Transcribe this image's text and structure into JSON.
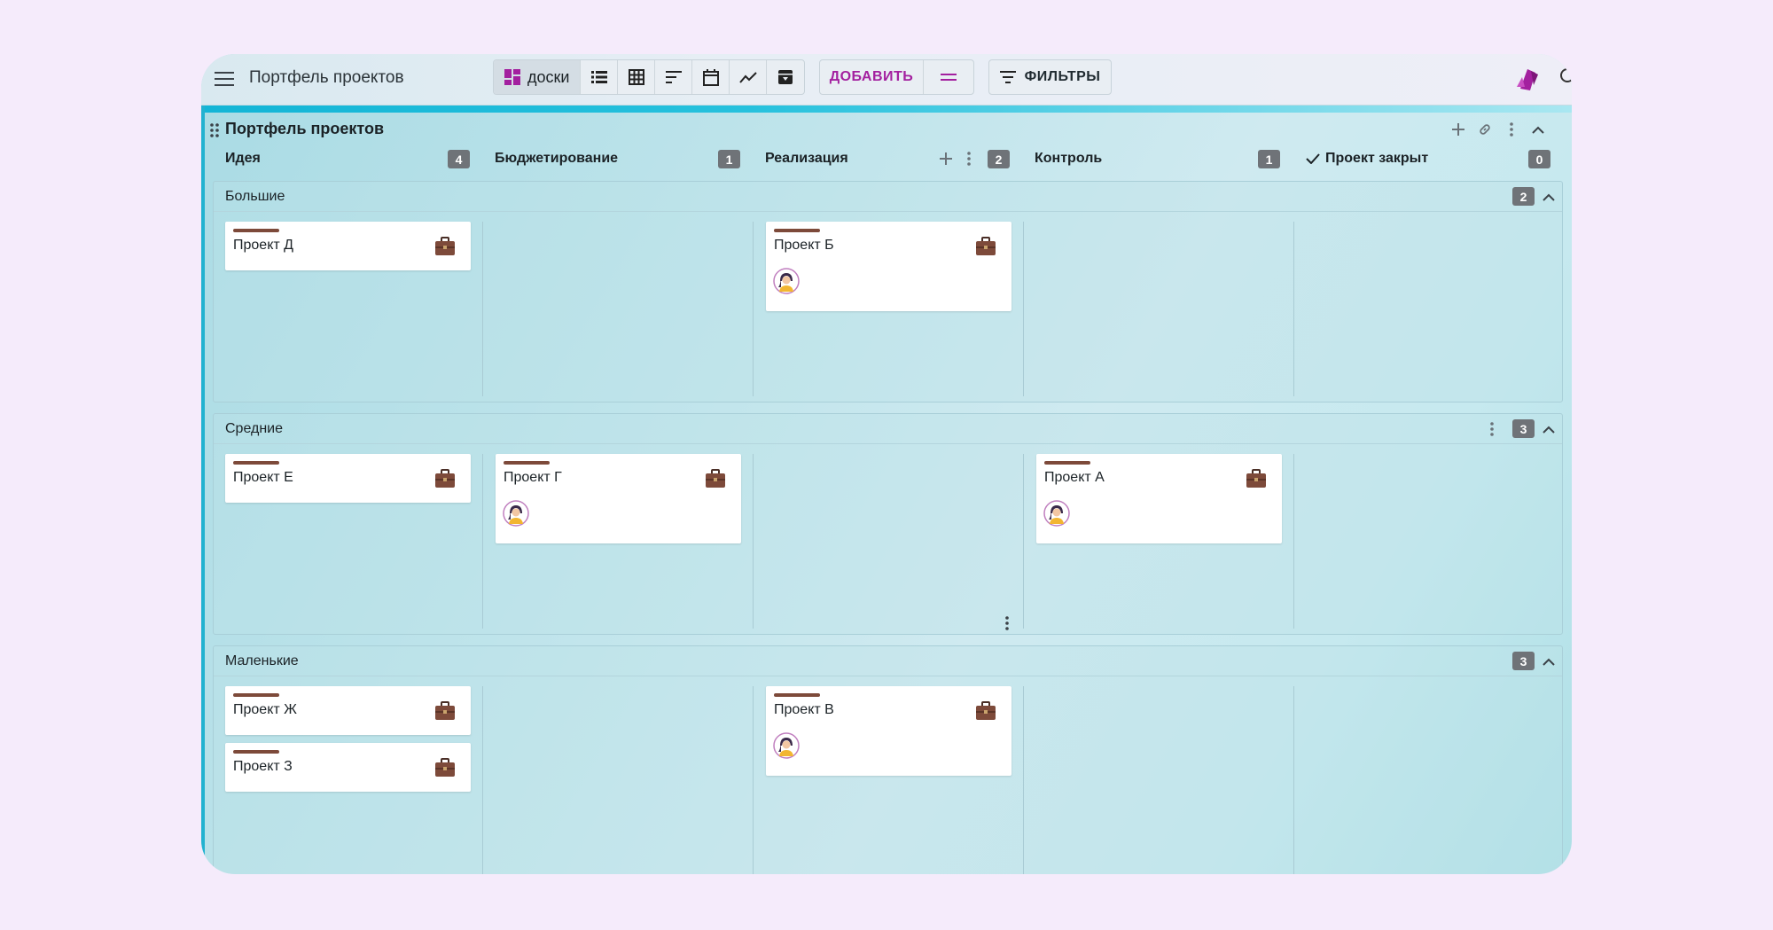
{
  "app": {
    "title": "Портфель проектов",
    "views": [
      {
        "name": "boards",
        "label": "доски",
        "active": true
      },
      {
        "name": "list",
        "label": ""
      },
      {
        "name": "table",
        "label": ""
      },
      {
        "name": "gantt",
        "label": ""
      },
      {
        "name": "calendar",
        "label": ""
      },
      {
        "name": "chart",
        "label": ""
      },
      {
        "name": "archive",
        "label": ""
      }
    ],
    "add_label": "ДОБАВИТЬ",
    "filters_label": "ФИЛЬТРЫ",
    "accent_color": "#a3209f"
  },
  "board": {
    "title": "Портфель проектов",
    "columns": [
      {
        "title": "Идея",
        "count": "4"
      },
      {
        "title": "Бюджетирование",
        "count": "1"
      },
      {
        "title": "Реализация",
        "count": "2"
      },
      {
        "title": "Контроль",
        "count": "1"
      },
      {
        "title": "Проект закрыт",
        "count": "0"
      }
    ],
    "lanes": [
      {
        "title": "Большие",
        "count": "2",
        "cards": [
          {
            "title": "Проект Д",
            "column": 0,
            "avatar": false
          },
          {
            "title": "Проект Б",
            "column": 2,
            "avatar": true
          }
        ]
      },
      {
        "title": "Средние",
        "count": "3",
        "cards": [
          {
            "title": "Проект Е",
            "column": 0,
            "avatar": false
          },
          {
            "title": "Проект Г",
            "column": 1,
            "avatar": true
          },
          {
            "title": "Проект А",
            "column": 3,
            "avatar": true
          }
        ]
      },
      {
        "title": "Маленькие",
        "count": "3",
        "cards": [
          {
            "title": "Проект Ж",
            "column": 0,
            "avatar": false
          },
          {
            "title": "Проект З",
            "column": 0,
            "avatar": false
          },
          {
            "title": "Проект В",
            "column": 2,
            "avatar": true
          }
        ]
      }
    ]
  }
}
